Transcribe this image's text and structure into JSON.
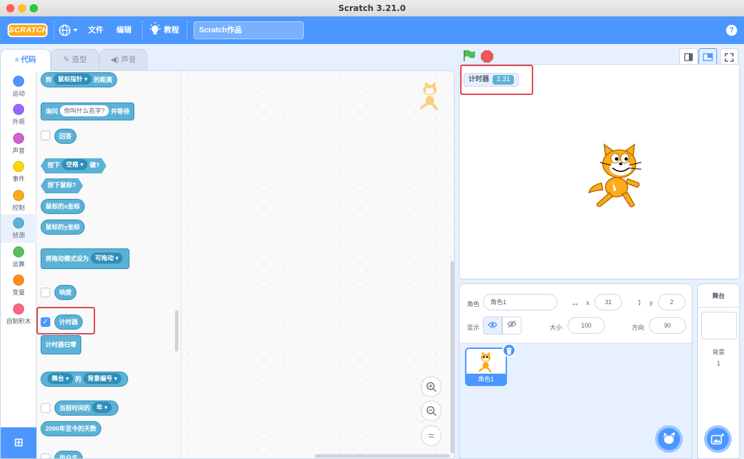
{
  "window": {
    "title": "Scratch 3.21.0"
  },
  "menubar": {
    "logo": "SCRATCH",
    "file": "文件",
    "edit": "编辑",
    "tutorials": "教程",
    "project_title": "Scratch作品",
    "help": "?"
  },
  "tabs": {
    "code": "代码",
    "costumes": "造型",
    "sounds": "声音"
  },
  "categories": [
    {
      "label": "运动",
      "color": "#4c97ff"
    },
    {
      "label": "外观",
      "color": "#9966ff"
    },
    {
      "label": "声音",
      "color": "#cf63cf"
    },
    {
      "label": "事件",
      "color": "#ffd500"
    },
    {
      "label": "控制",
      "color": "#ffab19"
    },
    {
      "label": "侦测",
      "color": "#5cb1d6"
    },
    {
      "label": "运算",
      "color": "#59c059"
    },
    {
      "label": "变量",
      "color": "#ff8c1a"
    },
    {
      "label": "自制积木",
      "color": "#ff6680"
    }
  ],
  "blocks": {
    "distance_to": "到",
    "distance_target": "鼠标指针",
    "distance_suffix": "的距离",
    "ask": "询问",
    "ask_input": "你叫什么名字?",
    "ask_suffix": "并等待",
    "answer": "回答",
    "key_pressed": "按下",
    "key_name": "空格",
    "key_suffix": "键?",
    "mouse_down": "按下鼠标?",
    "mouse_x": "鼠标的x坐标",
    "mouse_y": "鼠标的y坐标",
    "drag_mode": "将拖动模式设为",
    "drag_value": "可拖动",
    "loudness": "响度",
    "timer": "计时器",
    "reset_timer": "计时器归零",
    "of_target": "舞台",
    "of_word": "的",
    "of_attr": "背景编号",
    "current": "当前时间的",
    "current_unit": "年",
    "days_since": "2000年至今的天数",
    "username": "用户名"
  },
  "zoom": {
    "in": "+",
    "out": "−",
    "reset": "="
  },
  "stage": {
    "monitor_label": "计时器",
    "monitor_value": "2.31"
  },
  "sprite_info": {
    "sprite_label": "角色",
    "sprite_name": "角色1",
    "x_label": "x",
    "x_value": "31",
    "y_label": "y",
    "y_value": "2",
    "show_label": "显示",
    "size_label": "大小",
    "size_value": "100",
    "direction_label": "方向",
    "direction_value": "90"
  },
  "sprites": [
    {
      "name": "角色1"
    }
  ],
  "stage_panel": {
    "title": "舞台",
    "backdrops_label": "背景",
    "backdrops_count": "1"
  }
}
